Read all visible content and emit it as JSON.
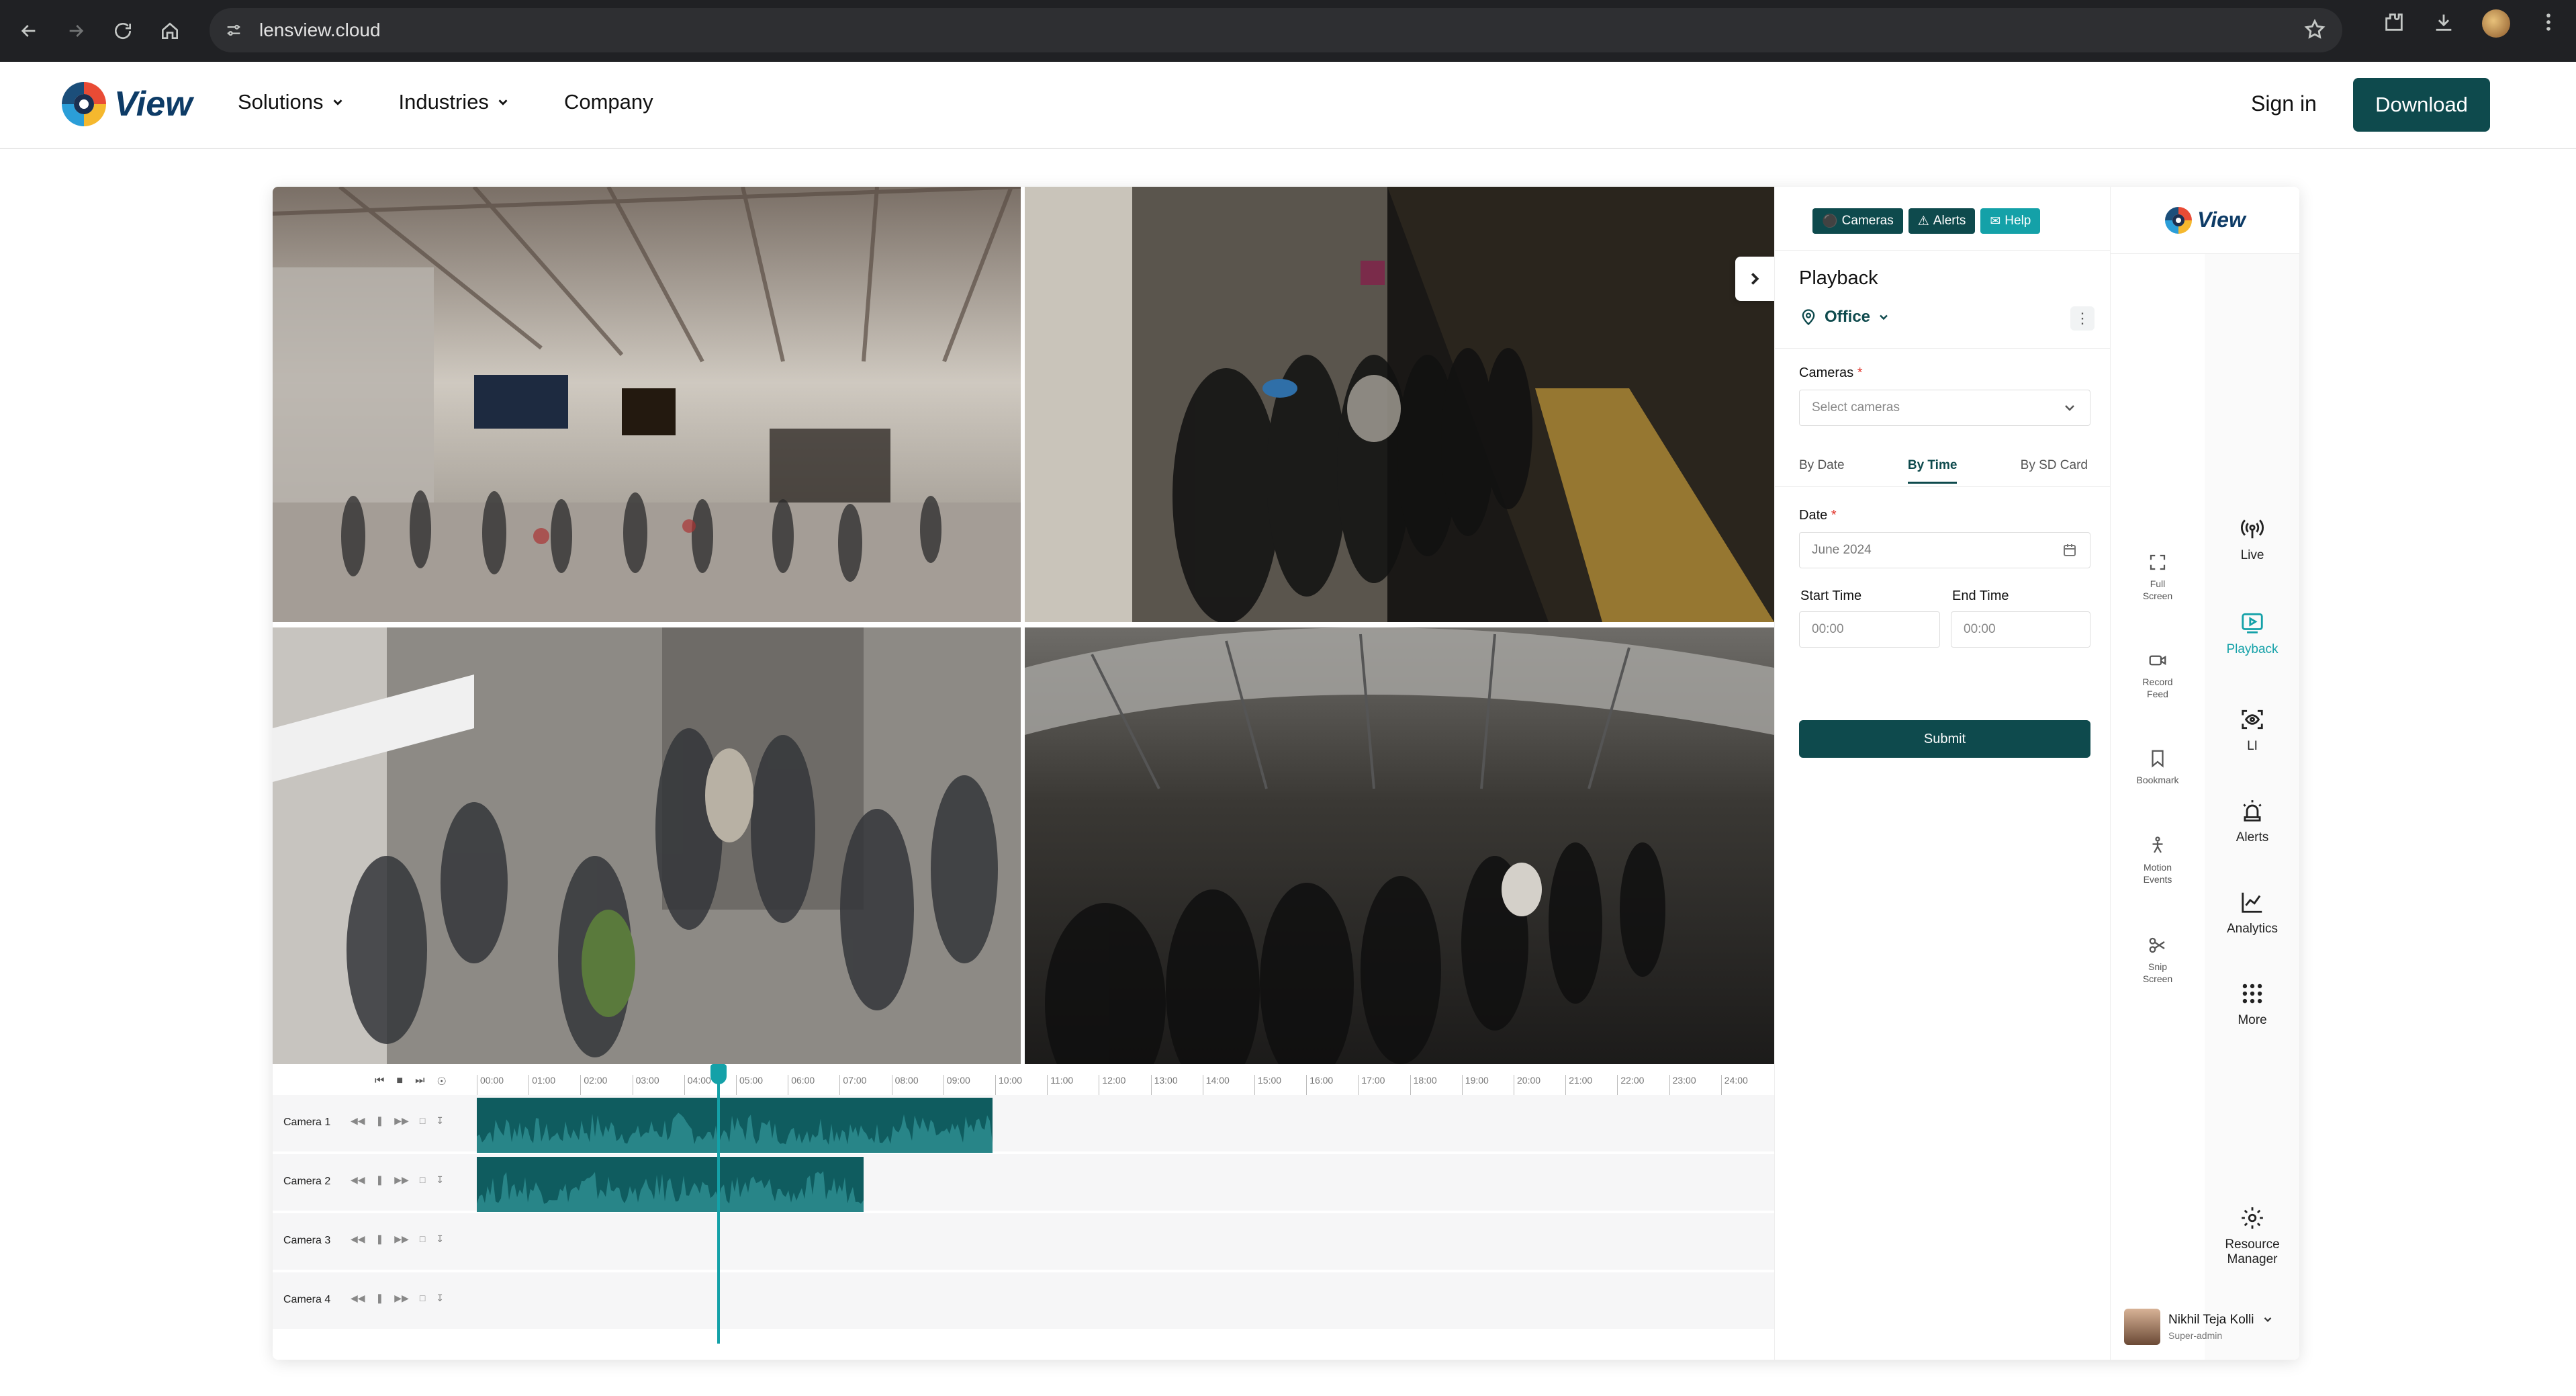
{
  "browser": {
    "url": "lensview.cloud"
  },
  "site": {
    "logo_text": "View",
    "menu": [
      {
        "label": "Solutions",
        "has_dropdown": true
      },
      {
        "label": "Industries",
        "has_dropdown": true
      },
      {
        "label": "Company",
        "has_dropdown": false
      }
    ],
    "sign_in": "Sign in",
    "download": "Download"
  },
  "timeline": {
    "hours": [
      "00:00",
      "01:00",
      "02:00",
      "03:00",
      "04:00",
      "05:00",
      "06:00",
      "07:00",
      "08:00",
      "09:00",
      "10:00",
      "11:00",
      "12:00",
      "13:00",
      "14:00",
      "15:00",
      "16:00",
      "17:00",
      "18:00",
      "19:00",
      "20:00",
      "21:00",
      "22:00",
      "23:00",
      "24:00"
    ],
    "rows": [
      {
        "label": "Camera 1"
      },
      {
        "label": "Camera 2"
      },
      {
        "label": "Camera 3"
      },
      {
        "label": "Camera 4"
      }
    ]
  },
  "panel": {
    "buttons": {
      "cameras": "Cameras",
      "alerts": "Alerts",
      "help": "Help"
    },
    "title": "Playback",
    "location": "Office",
    "cameras_label": "Cameras",
    "cameras_placeholder": "Select cameras",
    "tabs": [
      "By Date",
      "By Time",
      "By SD Card"
    ],
    "active_tab": "By Time",
    "date_label": "Date",
    "date_value": "June 2024",
    "start_label": "Start Time",
    "start_value": "00:00",
    "end_label": "End Time",
    "end_value": "00:00",
    "submit": "Submit"
  },
  "rail": {
    "logo_text": "View",
    "tools": [
      {
        "label": "Full Screen",
        "icon": "fullscreen-icon"
      },
      {
        "label": "Record Feed",
        "icon": "video-camera-icon"
      },
      {
        "label": "Bookmark",
        "icon": "bookmark-icon"
      },
      {
        "label": "Motion Events",
        "icon": "motion-icon"
      },
      {
        "label": "Snip Screen",
        "icon": "scissors-icon"
      }
    ],
    "nav": [
      {
        "label": "Live",
        "icon": "broadcast-icon"
      },
      {
        "label": "Playback",
        "icon": "playback-icon",
        "active": true
      },
      {
        "label": "LI",
        "icon": "scan-eye-icon"
      },
      {
        "label": "Alerts",
        "icon": "siren-icon"
      },
      {
        "label": "Analytics",
        "icon": "chart-icon"
      },
      {
        "label": "More",
        "icon": "grid-dots-icon"
      }
    ],
    "resource_manager": "Resource Manager",
    "user_name": "Nikhil Teja Kolli",
    "user_role": "Super-admin"
  },
  "colors": {
    "brand_dark": "#0e4a4d",
    "brand_accent": "#14a1a8"
  }
}
